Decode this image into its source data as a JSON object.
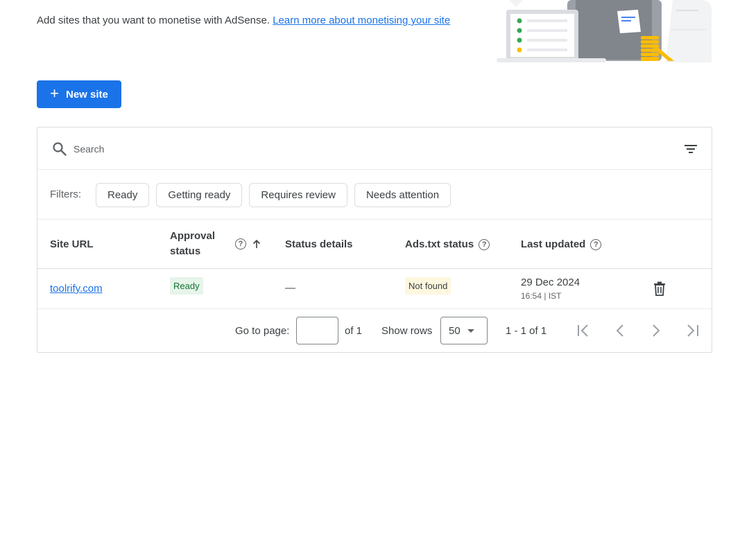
{
  "intro": {
    "text": "Add sites that you want to monetise with AdSense.",
    "link": "Learn more about monetising your site"
  },
  "toolbar": {
    "new_site_label": "New site"
  },
  "search": {
    "placeholder": "Search"
  },
  "filters": {
    "label": "Filters:",
    "chips": [
      "Ready",
      "Getting ready",
      "Requires review",
      "Needs attention"
    ]
  },
  "table": {
    "headers": {
      "site_url": "Site URL",
      "approval_status_line1": "Approval",
      "approval_status_line2": "status",
      "status_details": "Status details",
      "ads_txt_status": "Ads.txt status",
      "last_updated": "Last updated"
    },
    "rows": [
      {
        "site_url": "toolrify.com",
        "approval_status": "Ready",
        "status_details": "—",
        "ads_txt_status": "Not found",
        "date": "29 Dec 2024",
        "time": "16:54 | IST"
      }
    ]
  },
  "pagination": {
    "go_to_page_label": "Go to page:",
    "page_value": "",
    "of_pages": "of 1",
    "show_rows_label": "Show rows",
    "rows_per_page": "50",
    "range": "1 - 1 of 1"
  },
  "colors": {
    "primary": "#1a73e8",
    "ready_bg": "#e6f4ea",
    "ready_text": "#137333",
    "notfound_bg": "#fef7e0"
  }
}
